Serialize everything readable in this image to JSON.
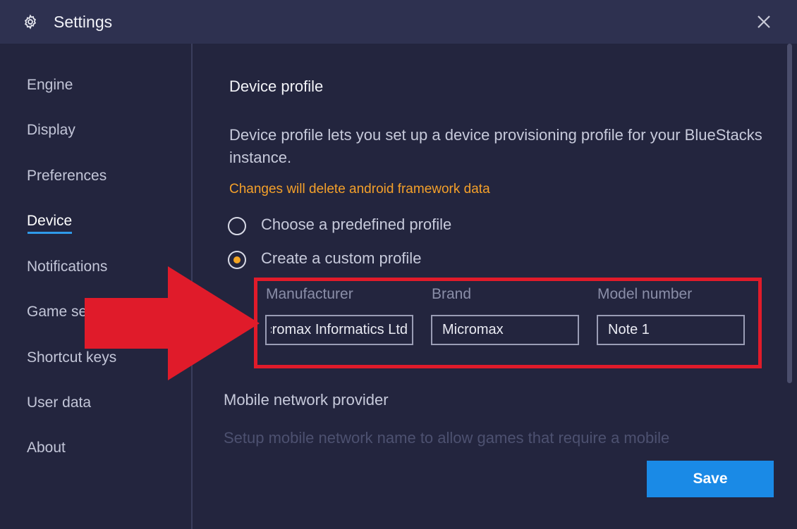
{
  "window": {
    "title": "Settings",
    "settings_icon": "gear-icon",
    "close_icon": "close-icon"
  },
  "sidebar": {
    "items": [
      {
        "label": "Engine",
        "active": false
      },
      {
        "label": "Display",
        "active": false
      },
      {
        "label": "Preferences",
        "active": false
      },
      {
        "label": "Device",
        "active": true
      },
      {
        "label": "Notifications",
        "active": false
      },
      {
        "label": "Game se",
        "active": false
      },
      {
        "label": "Shortcut keys",
        "active": false
      },
      {
        "label": "User data",
        "active": false
      },
      {
        "label": "About",
        "active": false
      }
    ]
  },
  "device_profile": {
    "title": "Device profile",
    "description": "Device profile lets you set up a device provisioning profile for your BlueStacks instance.",
    "warning": "Changes will delete android framework data",
    "options": [
      {
        "label": "Choose a predefined profile",
        "checked": false
      },
      {
        "label": "Create a custom profile",
        "checked": true
      }
    ],
    "fields": {
      "manufacturer": {
        "label": "Manufacturer",
        "value": "Micromax Informatics Ltd."
      },
      "brand": {
        "label": "Brand",
        "value": "Micromax"
      },
      "model": {
        "label": "Model number",
        "value": "Note 1"
      }
    }
  },
  "mobile_network": {
    "title": "Mobile network provider",
    "description": "Setup mobile network name to allow games that require a mobile"
  },
  "footer": {
    "save_label": "Save"
  },
  "colors": {
    "background": "#23253e",
    "titlebar": "#2e3150",
    "accent_blue": "#1a8ae6",
    "warning_orange": "#f4a02a",
    "annotation_red": "#e01b2a"
  }
}
